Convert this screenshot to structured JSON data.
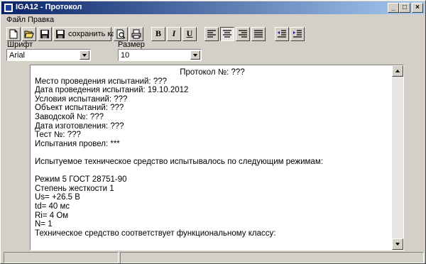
{
  "window": {
    "title": "IGA12 - Протокол"
  },
  "title_buttons": {
    "minimize": "_",
    "maximize": "□",
    "close": "×"
  },
  "menu": [
    "Файл",
    "Правка"
  ],
  "toolbar": {
    "save_as_label": "сохранить как",
    "bold": "B",
    "italic": "I",
    "underline": "U"
  },
  "font": {
    "label": "Шрифт",
    "value": "Arial"
  },
  "size": {
    "label": "Размер",
    "value": "10"
  },
  "document": {
    "lines": [
      "Протокол №: ???",
      "Место проведения испытаний: ???",
      "Дата проведения испытаний: 19.10.2012",
      "Условия испытаний: ???",
      "Объект испытаний: ???",
      "Заводской №: ???",
      "Дата изготовления: ???",
      "Тест №: ???",
      "Испытания провел: ***",
      "",
      "Испытуемое техническое средство испытывалось по следующим режимам:",
      "",
      "Режим 5 ГОСТ 28751-90",
      "Степень жесткости 1",
      "Us= +26.5 В",
      "td= 40 мс",
      "Ri= 4 Ом",
      "N= 1",
      "Техническое средство соответствует функциональному классу:"
    ]
  }
}
